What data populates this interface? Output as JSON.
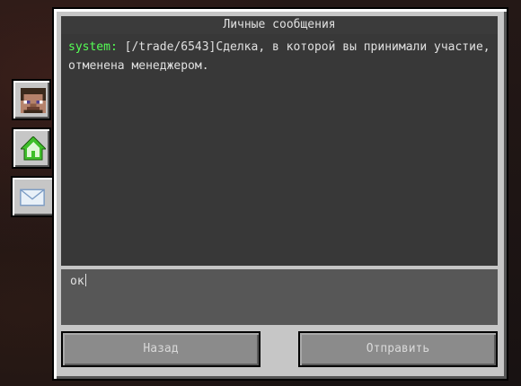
{
  "window": {
    "title": "Личные сообщения"
  },
  "messages": [
    {
      "sender": "system:",
      "text": " [/trade/6543]Сделка, в которой вы принимали участие, отменена менеджером."
    }
  ],
  "input": {
    "value": "ок"
  },
  "buttons": {
    "back_label": "Назад",
    "send_label": "Отправить"
  },
  "tabs": [
    {
      "icon": "player-head-icon",
      "active": false
    },
    {
      "icon": "home-icon",
      "active": false
    },
    {
      "icon": "envelope-icon",
      "active": true
    }
  ],
  "colors": {
    "sender": "#55ff55",
    "panel": "#c6c6c6",
    "message_area": "#383838",
    "input_area": "#575757"
  }
}
